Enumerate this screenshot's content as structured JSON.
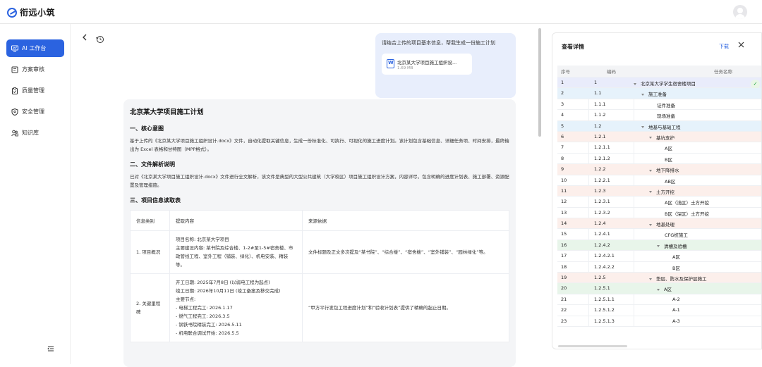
{
  "app": {
    "name": "衔远小筑"
  },
  "sidebar": {
    "items": [
      {
        "label": "AI 工作台",
        "icon": "monitor-icon",
        "active": true
      },
      {
        "label": "方案审核",
        "icon": "document-check-icon",
        "active": false
      },
      {
        "label": "质量管理",
        "icon": "clipboard-icon",
        "active": false
      },
      {
        "label": "安全管理",
        "icon": "shield-icon",
        "active": false
      },
      {
        "label": "知识库",
        "icon": "people-icon",
        "active": false
      }
    ]
  },
  "chat": {
    "user_message": "请结合上传的项目基本信息，帮我生成一份施工计划",
    "attachment": {
      "name": "北京某大学项目施工组织设...",
      "size": "1.69 MB"
    },
    "answer": {
      "title": "北京某大学项目施工计划",
      "sections": [
        {
          "heading": "一、核心意图",
          "text": "基于上传的《北京某大学项目施工组织设计.docx》文件，自动化提取关键信息，生成一份标准化、可执行、可视化的施工进度计划。该计划包含基础信息、详细任务项、时间安排，最终输出为 Excel 表格和甘特图（MPP格式）。"
        },
        {
          "heading": "二、文件解析说明",
          "text": "已对《北京某大学项目施工组织设计.docx》文件进行全文解析，该文件是典型的大型公共建筑（大学校区）项目施工组织设计方案，内容详尽，包含明确的进度计划表、施工部署、资源配置及管理措施。"
        },
        {
          "heading": "三、项目信息读取表",
          "text": ""
        }
      ],
      "table": {
        "headers": [
          "信息类别",
          "提取内容",
          "来源依据"
        ],
        "rows": [
          {
            "category": "1. 项目概况",
            "content": [
              "项目名称: 北京某大学项目",
              "主要建设内容: 某书院及综合楼、1-2#至1-5#宿舍楼、市政管线工程、室外工程（铺装、绿化）、机电安装、精装等。"
            ],
            "source": "文件标题及正文多次提及“某书院”、“综合楼”、“宿舍楼”、“室外铺装”、“园林绿化”等。"
          },
          {
            "category": "2. 关键里程碑",
            "content": [
              "开工日期: 2025年7月8日 (以弱电工程为起点)",
              "竣工日期: 2026年10月11日 (竣工备案及移交完成)",
              "主要节点:",
              "- 电梯工程完工: 2026.1.17",
              "- 燃气工程完工: 2026.3.5",
              "- 钢铁书院精装完工: 2026.5.11",
              "- 机电联合调试开始: 2026.5.5"
            ],
            "source": "“甲方平行发包工程进度计划”和“验收计划表”提供了精确的起止日期。"
          }
        ]
      }
    }
  },
  "panel": {
    "title": "查看详情",
    "download_label": "下载",
    "columns": [
      "序号",
      "编码",
      "任务名称"
    ],
    "rows": [
      {
        "no": "1",
        "code": "1",
        "name": "北京某大学学生宿舍楼项目",
        "level": 0,
        "expand": true,
        "tint": "#e9ecfb"
      },
      {
        "no": "2",
        "code": "1.1",
        "name": "施工准备",
        "level": 1,
        "expand": true,
        "tint": "#e6f2fb"
      },
      {
        "no": "3",
        "code": "1.1.1",
        "name": "证件准备",
        "level": 2,
        "expand": false,
        "tint": ""
      },
      {
        "no": "4",
        "code": "1.1.2",
        "name": "现场准备",
        "level": 2,
        "expand": false,
        "tint": ""
      },
      {
        "no": "5",
        "code": "1.2",
        "name": "地基与基础工程",
        "level": 1,
        "expand": true,
        "tint": "#e6f2fb"
      },
      {
        "no": "6",
        "code": "1.2.1",
        "name": "基坑支护",
        "level": 2,
        "expand": true,
        "tint": "#fcefeb"
      },
      {
        "no": "7",
        "code": "1.2.1.1",
        "name": "A区",
        "level": 3,
        "expand": false,
        "tint": ""
      },
      {
        "no": "8",
        "code": "1.2.1.2",
        "name": "B区",
        "level": 3,
        "expand": false,
        "tint": ""
      },
      {
        "no": "9",
        "code": "1.2.2",
        "name": "地下降排水",
        "level": 2,
        "expand": true,
        "tint": "#fcefeb"
      },
      {
        "no": "10",
        "code": "1.2.2.1",
        "name": "AB区",
        "level": 3,
        "expand": false,
        "tint": ""
      },
      {
        "no": "11",
        "code": "1.2.3",
        "name": "土方开挖",
        "level": 2,
        "expand": true,
        "tint": "#fcefeb"
      },
      {
        "no": "12",
        "code": "1.2.3.1",
        "name": "A区（浅区）土方开挖",
        "level": 3,
        "expand": false,
        "tint": ""
      },
      {
        "no": "13",
        "code": "1.2.3.2",
        "name": "B区（深区）土方开挖",
        "level": 3,
        "expand": false,
        "tint": ""
      },
      {
        "no": "14",
        "code": "1.2.4",
        "name": "地基处理",
        "level": 2,
        "expand": true,
        "tint": "#fcefeb"
      },
      {
        "no": "15",
        "code": "1.2.4.1",
        "name": "CFG桩施工",
        "level": 3,
        "expand": false,
        "tint": ""
      },
      {
        "no": "16",
        "code": "1.2.4.2",
        "name": "清槽及验槽",
        "level": 3,
        "expand": true,
        "tint": "#e8f5ea"
      },
      {
        "no": "17",
        "code": "1.2.4.2.1",
        "name": "A区",
        "level": 4,
        "expand": false,
        "tint": ""
      },
      {
        "no": "18",
        "code": "1.2.4.2.2",
        "name": "B区",
        "level": 4,
        "expand": false,
        "tint": ""
      },
      {
        "no": "19",
        "code": "1.2.5",
        "name": "垫层、防水及保护层施工",
        "level": 2,
        "expand": true,
        "tint": "#fcefeb"
      },
      {
        "no": "20",
        "code": "1.2.5.1",
        "name": "A区",
        "level": 3,
        "expand": true,
        "tint": "#e8f5ea"
      },
      {
        "no": "21",
        "code": "1.2.5.1.1",
        "name": "A-2",
        "level": 4,
        "expand": false,
        "tint": ""
      },
      {
        "no": "22",
        "code": "1.2.5.1.2",
        "name": "A-1",
        "level": 4,
        "expand": false,
        "tint": ""
      },
      {
        "no": "23",
        "code": "1.2.5.1.3",
        "name": "A-3",
        "level": 4,
        "expand": false,
        "tint": ""
      }
    ]
  },
  "colors": {
    "accent": "#2b63e0"
  }
}
